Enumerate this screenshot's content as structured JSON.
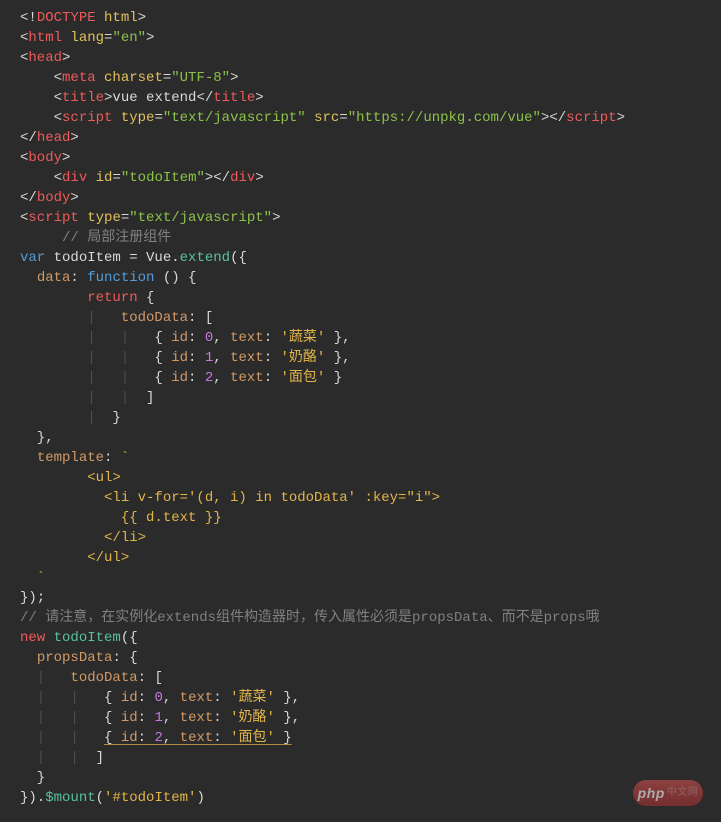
{
  "watermark": {
    "main": "php",
    "small": "中文网"
  },
  "code_lines": [
    [
      {
        "c": "p-white",
        "t": "<!"
      },
      {
        "c": "p-red",
        "t": "DOCTYPE"
      },
      {
        "c": "p-white",
        "t": " "
      },
      {
        "c": "p-yel",
        "t": "html"
      },
      {
        "c": "p-white",
        "t": ">"
      }
    ],
    [
      {
        "c": "p-white",
        "t": "<"
      },
      {
        "c": "p-red",
        "t": "html"
      },
      {
        "c": "p-white",
        "t": " "
      },
      {
        "c": "p-yel",
        "t": "lang"
      },
      {
        "c": "p-white",
        "t": "="
      },
      {
        "c": "p-green",
        "t": "\"en\""
      },
      {
        "c": "p-white",
        "t": ">"
      }
    ],
    [
      {
        "c": "p-white",
        "t": "<"
      },
      {
        "c": "p-red",
        "t": "head"
      },
      {
        "c": "p-white",
        "t": ">"
      }
    ],
    [
      {
        "c": "p-white",
        "t": "    <"
      },
      {
        "c": "p-red",
        "t": "meta"
      },
      {
        "c": "p-white",
        "t": " "
      },
      {
        "c": "p-yel",
        "t": "charset"
      },
      {
        "c": "p-white",
        "t": "="
      },
      {
        "c": "p-green",
        "t": "\"UTF-8\""
      },
      {
        "c": "p-white",
        "t": ">"
      }
    ],
    [
      {
        "c": "p-white",
        "t": "    <"
      },
      {
        "c": "p-red",
        "t": "title"
      },
      {
        "c": "p-white",
        "t": ">vue extend</"
      },
      {
        "c": "p-red",
        "t": "title"
      },
      {
        "c": "p-white",
        "t": ">"
      }
    ],
    [
      {
        "c": "p-white",
        "t": "    <"
      },
      {
        "c": "p-red",
        "t": "script"
      },
      {
        "c": "p-white",
        "t": " "
      },
      {
        "c": "p-yel",
        "t": "type"
      },
      {
        "c": "p-white",
        "t": "="
      },
      {
        "c": "p-green",
        "t": "\"text/javascript\""
      },
      {
        "c": "p-white",
        "t": " "
      },
      {
        "c": "p-yel",
        "t": "src"
      },
      {
        "c": "p-white",
        "t": "="
      },
      {
        "c": "p-green",
        "t": "\"https://unpkg.com/vue\""
      },
      {
        "c": "p-white",
        "t": "></"
      },
      {
        "c": "p-red",
        "t": "script"
      },
      {
        "c": "p-white",
        "t": ">"
      }
    ],
    [
      {
        "c": "p-white",
        "t": "</"
      },
      {
        "c": "p-red",
        "t": "head"
      },
      {
        "c": "p-white",
        "t": ">"
      }
    ],
    [
      {
        "c": "p-white",
        "t": "<"
      },
      {
        "c": "p-red",
        "t": "body"
      },
      {
        "c": "p-white",
        "t": ">"
      }
    ],
    [
      {
        "c": "p-white",
        "t": "    <"
      },
      {
        "c": "p-red",
        "t": "div"
      },
      {
        "c": "p-white",
        "t": " "
      },
      {
        "c": "p-yel",
        "t": "id"
      },
      {
        "c": "p-white",
        "t": "="
      },
      {
        "c": "p-green",
        "t": "\"todoItem\""
      },
      {
        "c": "p-white",
        "t": "></"
      },
      {
        "c": "p-red",
        "t": "div"
      },
      {
        "c": "p-white",
        "t": ">"
      }
    ],
    [
      {
        "c": "p-white",
        "t": "</"
      },
      {
        "c": "p-red",
        "t": "body"
      },
      {
        "c": "p-white",
        "t": ">"
      }
    ],
    [
      {
        "c": "p-white",
        "t": "<"
      },
      {
        "c": "p-red",
        "t": "script"
      },
      {
        "c": "p-white",
        "t": " "
      },
      {
        "c": "p-yel",
        "t": "type"
      },
      {
        "c": "p-white",
        "t": "="
      },
      {
        "c": "p-green",
        "t": "\"text/javascript\""
      },
      {
        "c": "p-white",
        "t": ">"
      }
    ],
    [
      {
        "c": "p-white",
        "t": "     "
      },
      {
        "c": "p-cmt",
        "t": "// 局部注册组件"
      }
    ],
    [
      {
        "c": "p-key",
        "t": "var"
      },
      {
        "c": "p-white",
        "t": " todoItem = Vue."
      },
      {
        "c": "p-fn",
        "t": "extend"
      },
      {
        "c": "p-white",
        "t": "({"
      }
    ],
    [
      {
        "c": "p-white",
        "t": "  "
      },
      {
        "c": "p-orn",
        "t": "data"
      },
      {
        "c": "p-white",
        "t": ": "
      },
      {
        "c": "p-key",
        "t": "function"
      },
      {
        "c": "p-white",
        "t": " () {"
      }
    ],
    [
      {
        "c": "p-white",
        "t": "        "
      },
      {
        "c": "p-red",
        "t": "return "
      },
      {
        "c": "p-white",
        "t": "{"
      }
    ],
    [
      {
        "c": "guide",
        "t": "        |   "
      },
      {
        "c": "p-orn",
        "t": "todoData"
      },
      {
        "c": "p-white",
        "t": ": ["
      }
    ],
    [
      {
        "c": "guide",
        "t": "        |   |   "
      },
      {
        "c": "p-white",
        "t": "{ "
      },
      {
        "c": "p-orn",
        "t": "id"
      },
      {
        "c": "p-white",
        "t": ": "
      },
      {
        "c": "p-num",
        "t": "0"
      },
      {
        "c": "p-white",
        "t": ", "
      },
      {
        "c": "p-orn",
        "t": "text"
      },
      {
        "c": "p-white",
        "t": ": "
      },
      {
        "c": "p-str",
        "t": "'蔬菜'"
      },
      {
        "c": "p-white",
        "t": " },"
      }
    ],
    [
      {
        "c": "guide",
        "t": "        |   |   "
      },
      {
        "c": "p-white",
        "t": "{ "
      },
      {
        "c": "p-orn",
        "t": "id"
      },
      {
        "c": "p-white",
        "t": ": "
      },
      {
        "c": "p-num",
        "t": "1"
      },
      {
        "c": "p-white",
        "t": ", "
      },
      {
        "c": "p-orn",
        "t": "text"
      },
      {
        "c": "p-white",
        "t": ": "
      },
      {
        "c": "p-str",
        "t": "'奶酪'"
      },
      {
        "c": "p-white",
        "t": " },"
      }
    ],
    [
      {
        "c": "guide",
        "t": "        |   |   "
      },
      {
        "c": "p-white",
        "t": "{ "
      },
      {
        "c": "p-orn",
        "t": "id"
      },
      {
        "c": "p-white",
        "t": ": "
      },
      {
        "c": "p-num",
        "t": "2"
      },
      {
        "c": "p-white",
        "t": ", "
      },
      {
        "c": "p-orn",
        "t": "text"
      },
      {
        "c": "p-white",
        "t": ": "
      },
      {
        "c": "p-str",
        "t": "'面包'"
      },
      {
        "c": "p-white",
        "t": " }"
      }
    ],
    [
      {
        "c": "guide",
        "t": "        |   |  "
      },
      {
        "c": "p-white",
        "t": "]"
      }
    ],
    [
      {
        "c": "guide",
        "t": "        |  "
      },
      {
        "c": "p-white",
        "t": "}"
      }
    ],
    [
      {
        "c": "p-white",
        "t": "  },"
      }
    ],
    [
      {
        "c": "p-white",
        "t": "  "
      },
      {
        "c": "p-orn",
        "t": "template"
      },
      {
        "c": "p-white",
        "t": ": "
      },
      {
        "c": "p-str",
        "t": "`"
      }
    ],
    [
      {
        "c": "p-str",
        "t": "        <ul>"
      }
    ],
    [
      {
        "c": "p-str",
        "t": "          <li v-for='(d, i) in todoData' :key=\"i\">"
      }
    ],
    [
      {
        "c": "p-str",
        "t": "            {{ d.text }}"
      }
    ],
    [
      {
        "c": "p-str",
        "t": "          </li>"
      }
    ],
    [
      {
        "c": "p-str",
        "t": "        </ul>"
      }
    ],
    [
      {
        "c": "p-str",
        "t": "  `"
      }
    ],
    [
      {
        "c": "p-white",
        "t": "});"
      }
    ],
    [
      {
        "c": "p-cmt",
        "t": "// 请注意，在实例化extends组件构造器时，传入属性必须是propsData、而不是props哦"
      }
    ],
    [
      {
        "c": "p-red",
        "t": "new"
      },
      {
        "c": "p-white",
        "t": " "
      },
      {
        "c": "p-fn",
        "t": "todoItem"
      },
      {
        "c": "p-white",
        "t": "({"
      }
    ],
    [
      {
        "c": "p-white",
        "t": "  "
      },
      {
        "c": "p-orn",
        "t": "propsData"
      },
      {
        "c": "p-white",
        "t": ": {"
      }
    ],
    [
      {
        "c": "guide",
        "t": "  |   "
      },
      {
        "c": "p-orn",
        "t": "todoData"
      },
      {
        "c": "p-white",
        "t": ": ["
      }
    ],
    [
      {
        "c": "guide",
        "t": "  |   |   "
      },
      {
        "c": "p-white",
        "t": "{ "
      },
      {
        "c": "p-orn",
        "t": "id"
      },
      {
        "c": "p-white",
        "t": ": "
      },
      {
        "c": "p-num",
        "t": "0"
      },
      {
        "c": "p-white",
        "t": ", "
      },
      {
        "c": "p-orn",
        "t": "text"
      },
      {
        "c": "p-white",
        "t": ": "
      },
      {
        "c": "p-str",
        "t": "'蔬菜'"
      },
      {
        "c": "p-white",
        "t": " },"
      }
    ],
    [
      {
        "c": "guide",
        "t": "  |   |   "
      },
      {
        "c": "p-white",
        "t": "{ "
      },
      {
        "c": "p-orn",
        "t": "id"
      },
      {
        "c": "p-white",
        "t": ": "
      },
      {
        "c": "p-num",
        "t": "1"
      },
      {
        "c": "p-white",
        "t": ", "
      },
      {
        "c": "p-orn",
        "t": "text"
      },
      {
        "c": "p-white",
        "t": ": "
      },
      {
        "c": "p-str",
        "t": "'奶酪'"
      },
      {
        "c": "p-white",
        "t": " },"
      }
    ],
    [
      {
        "c": "guide",
        "t": "  |   |   "
      },
      {
        "c": "p-white uline",
        "t": "{ "
      },
      {
        "c": "p-orn uline",
        "t": "id"
      },
      {
        "c": "p-white uline",
        "t": ": "
      },
      {
        "c": "p-num uline",
        "t": "2"
      },
      {
        "c": "p-white uline",
        "t": ", "
      },
      {
        "c": "p-orn uline",
        "t": "text"
      },
      {
        "c": "p-white uline",
        "t": ": "
      },
      {
        "c": "p-str uline",
        "t": "'面包'"
      },
      {
        "c": "p-white uline",
        "t": " }"
      }
    ],
    [
      {
        "c": "guide",
        "t": "  |   |  "
      },
      {
        "c": "p-white",
        "t": "]"
      }
    ],
    [
      {
        "c": "p-white",
        "t": "  }"
      }
    ],
    [
      {
        "c": "p-white",
        "t": "})."
      },
      {
        "c": "p-fn",
        "t": "$mount"
      },
      {
        "c": "p-white",
        "t": "("
      },
      {
        "c": "p-str",
        "t": "'#todoItem'"
      },
      {
        "c": "p-white",
        "t": ")"
      }
    ]
  ]
}
